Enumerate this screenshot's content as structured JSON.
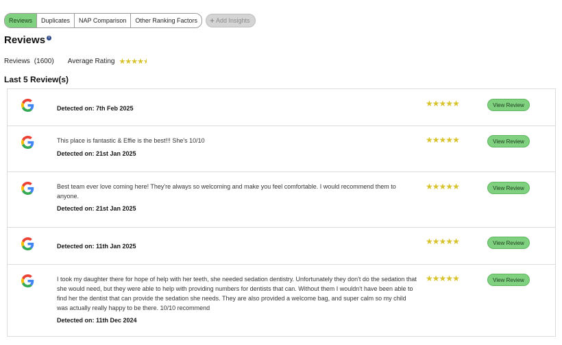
{
  "tabs": [
    {
      "label": "Reviews",
      "active": true
    },
    {
      "label": "Duplicates",
      "active": false
    },
    {
      "label": "NAP Comparison",
      "active": false
    },
    {
      "label": "Other Ranking Factors",
      "active": false
    }
  ],
  "add_insights_label": "Add Insights",
  "page_title": "Reviews",
  "stats": {
    "reviews_label": "Reviews",
    "reviews_count": "(1600)",
    "average_rating_label": "Average Rating",
    "average_rating": 4.5
  },
  "section_title": "Last 5 Review(s)",
  "reviews": [
    {
      "source_icon": "google-icon",
      "text": "",
      "detected": "Detected on: 7th Feb 2025",
      "rating": 5,
      "button": "View Review"
    },
    {
      "source_icon": "google-icon",
      "text": "This place is fantastic & Effie is the best!!! She's 10/10",
      "detected": "Detected on: 21st Jan 2025",
      "rating": 5,
      "button": "View Review"
    },
    {
      "source_icon": "google-icon",
      "text": "Best team ever love coming here! They're always so welcoming and make you feel comfortable. I would recommend them to anyone.",
      "detected": "Detected on: 21st Jan 2025",
      "rating": 5,
      "button": "View Review"
    },
    {
      "source_icon": "google-icon",
      "text": "",
      "detected": "Detected on: 11th Jan 2025",
      "rating": 5,
      "button": "View Review"
    },
    {
      "source_icon": "google-icon",
      "text": "I took my daughter there for hope of help with her teeth, she needed sedation dentistry. Unfortunately they don't do the sedation that she would need, but they were able to help with providing numbers for dentists that can. Without them I wouldn't have been able to find her the dentist that can provide the sedation she needs. They are also provided a welcome bag, and super calm so my child was actually really happy to be there. 10/10 recommend",
      "detected": "Detected on: 11th Dec 2024",
      "rating": 5,
      "button": "View Review"
    }
  ],
  "colors": {
    "accent_green": "#7fd17f",
    "star_gold": "#d8c22a",
    "info_blue": "#2c4a8c"
  }
}
